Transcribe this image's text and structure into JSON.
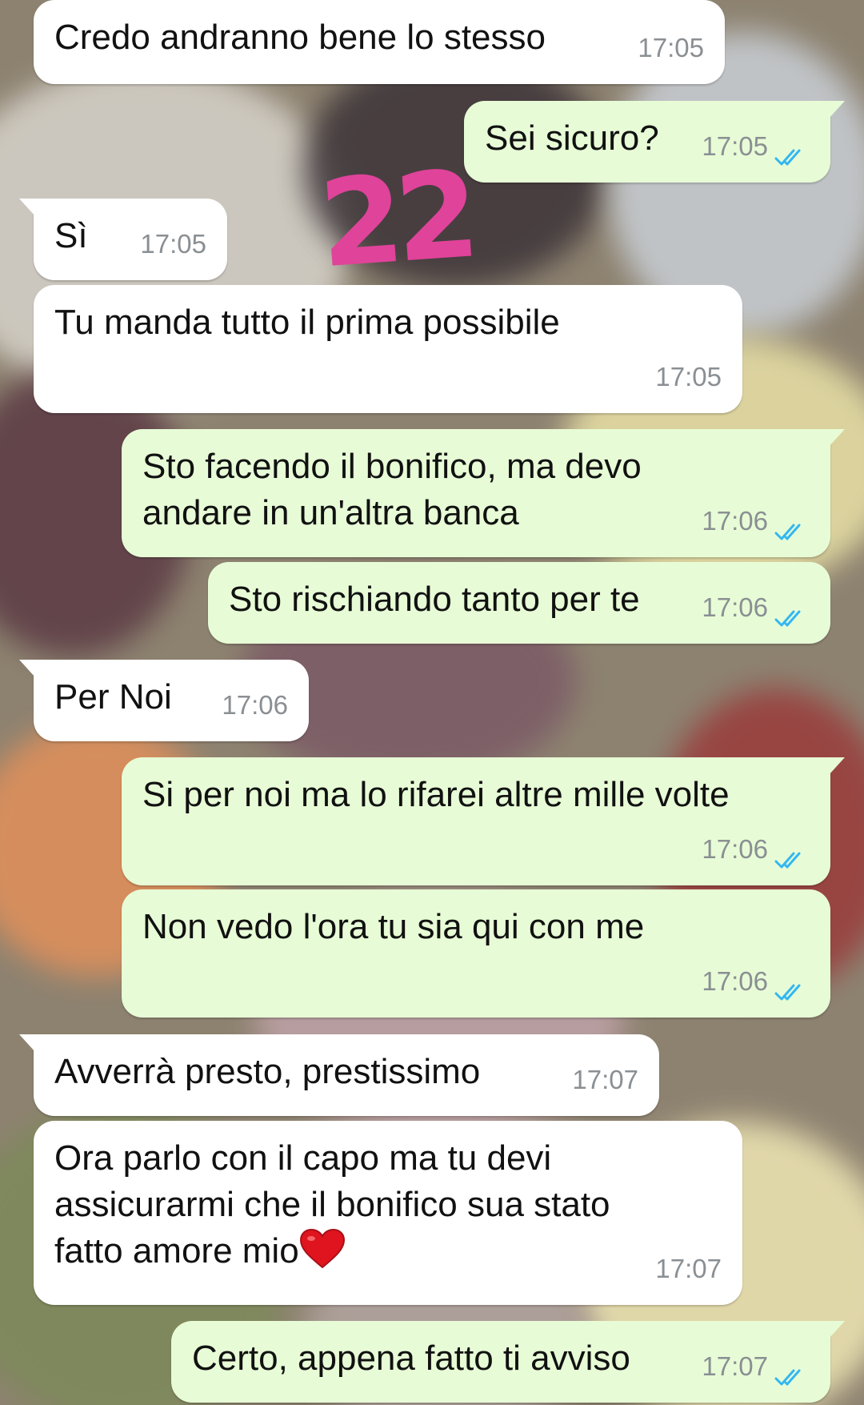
{
  "handwritten_mark": "22",
  "colors": {
    "incoming": "#ffffff",
    "outgoing": "#e7fcd6",
    "time": "#8a8f93",
    "read_ticks": "#34b7f1",
    "mark": "#e0439a"
  },
  "messages": [
    {
      "direction": "in",
      "text": "Credo andranno bene lo stesso",
      "time": "17:05"
    },
    {
      "direction": "out",
      "text": "Sei sicuro?",
      "time": "17:05",
      "status": "read"
    },
    {
      "direction": "in",
      "text": "Sì",
      "time": "17:05"
    },
    {
      "direction": "in",
      "text": "Tu manda tutto il prima possibile",
      "time": "17:05"
    },
    {
      "direction": "out",
      "text": "Sto facendo il bonifico, ma devo\nandare in un'altra banca",
      "time": "17:06",
      "status": "read"
    },
    {
      "direction": "out",
      "text": "Sto rischiando tanto per te",
      "time": "17:06",
      "status": "read"
    },
    {
      "direction": "in",
      "text": "Per Noi",
      "time": "17:06"
    },
    {
      "direction": "out",
      "text": "Si per noi ma lo rifarei altre mille volte",
      "time": "17:06",
      "status": "read"
    },
    {
      "direction": "out",
      "text": "Non vedo l'ora tu sia qui con me",
      "time": "17:06",
      "status": "read"
    },
    {
      "direction": "in",
      "text": "Avverrà presto, prestissimo",
      "time": "17:07"
    },
    {
      "direction": "in",
      "text": "Ora parlo con il capo ma tu devi\nassicurarmi che il bonifico sua stato\nfatto amore mio",
      "time": "17:07",
      "emoji": "red-heart"
    },
    {
      "direction": "out",
      "text": "Certo, appena fatto ti avviso",
      "time": "17:07",
      "status": "read"
    }
  ]
}
